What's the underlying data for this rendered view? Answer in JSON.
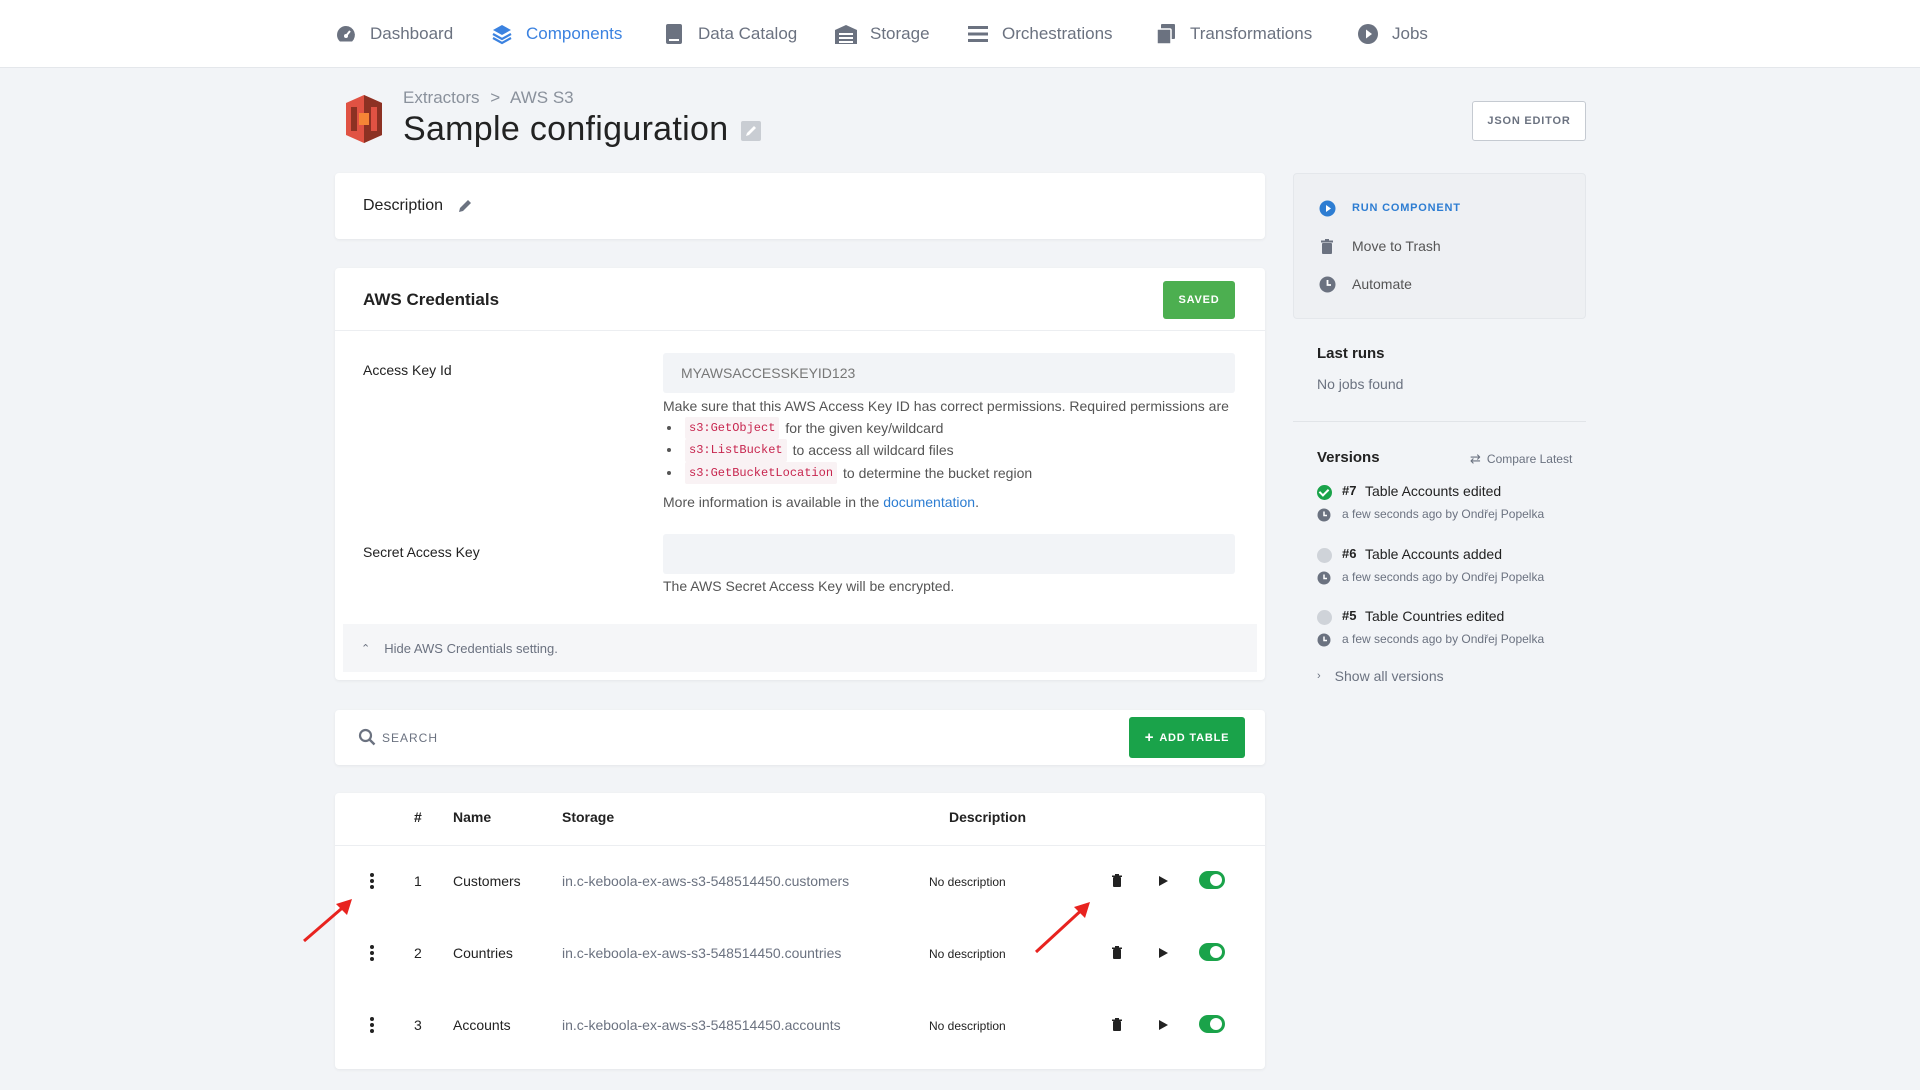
{
  "nav": {
    "items": [
      {
        "label": "Dashboard",
        "icon": "dashboard-icon",
        "active": false
      },
      {
        "label": "Components",
        "icon": "layers-icon",
        "active": true
      },
      {
        "label": "Data Catalog",
        "icon": "book-icon",
        "active": false
      },
      {
        "label": "Storage",
        "icon": "warehouse-icon",
        "active": false
      },
      {
        "label": "Orchestrations",
        "icon": "list-icon",
        "active": false
      },
      {
        "label": "Transformations",
        "icon": "copy-icon",
        "active": false
      },
      {
        "label": "Jobs",
        "icon": "play-circle-icon",
        "active": false
      }
    ]
  },
  "header": {
    "breadcrumb": [
      "Extractors",
      "AWS S3"
    ],
    "breadcrumb_separator": ">",
    "title": "Sample configuration",
    "json_editor_label": "JSON EDITOR"
  },
  "description": {
    "label": "Description"
  },
  "credentials": {
    "title": "AWS Credentials",
    "saved_label": "SAVED",
    "access_key_label": "Access Key Id",
    "access_key_value": "MYAWSACCESSKEYID123",
    "help_intro": "Make sure that this AWS Access Key ID has correct permissions. Required permissions are",
    "permissions": [
      {
        "code": "s3:GetObject",
        "text": "for the given key/wildcard"
      },
      {
        "code": "s3:ListBucket",
        "text": "to access all wildcard files"
      },
      {
        "code": "s3:GetBucketLocation",
        "text": "to determine the bucket region"
      }
    ],
    "more_info_prefix": "More information is available in the",
    "more_info_link": "documentation",
    "more_info_suffix": ".",
    "secret_key_label": "Secret Access Key",
    "secret_key_value": "",
    "secret_help": "The AWS Secret Access Key will be encrypted.",
    "hide_label": "Hide AWS Credentials setting."
  },
  "search": {
    "placeholder": "SEARCH",
    "add_table_label": "ADD TABLE"
  },
  "table": {
    "columns": [
      "#",
      "Name",
      "Storage",
      "Description"
    ],
    "rows": [
      {
        "num": "1",
        "name": "Customers",
        "storage": "in.c-keboola-ex-aws-s3-548514450.customers",
        "description": "No description",
        "enabled": true
      },
      {
        "num": "2",
        "name": "Countries",
        "storage": "in.c-keboola-ex-aws-s3-548514450.countries",
        "description": "No description",
        "enabled": true
      },
      {
        "num": "3",
        "name": "Accounts",
        "storage": "in.c-keboola-ex-aws-s3-548514450.accounts",
        "description": "No description",
        "enabled": true
      }
    ]
  },
  "sidebar": {
    "actions": [
      {
        "label": "RUN COMPONENT",
        "icon": "play-circle-icon"
      },
      {
        "label": "Move to Trash",
        "icon": "trash-icon"
      },
      {
        "label": "Automate",
        "icon": "clock-icon"
      }
    ],
    "last_runs_title": "Last runs",
    "last_runs_empty": "No jobs found",
    "versions_title": "Versions",
    "compare_label": "Compare Latest",
    "versions": [
      {
        "num": "#7",
        "text": "Table Accounts edited",
        "meta": "a few seconds ago by Ondřej Popelka",
        "current": true
      },
      {
        "num": "#6",
        "text": "Table Accounts added",
        "meta": "a few seconds ago by Ondřej Popelka",
        "current": false
      },
      {
        "num": "#5",
        "text": "Table Countries edited",
        "meta": "a few seconds ago by Ondřej Popelka",
        "current": false
      }
    ],
    "show_all_label": "Show all versions"
  },
  "colors": {
    "accent": "#3b82e0",
    "success": "#1aa34a",
    "saved": "#4caf50",
    "annotation": "#e8231f"
  }
}
